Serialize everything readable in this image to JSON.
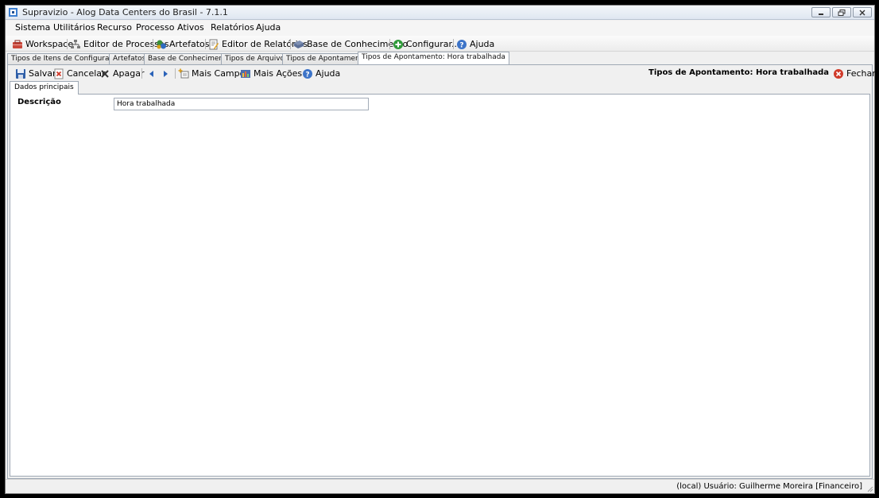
{
  "window": {
    "title": "Supravizio - Alog Data Centers do Brasil - 7.1.1"
  },
  "menubar": {
    "items": [
      "Sistema",
      "Utilitários",
      "Recurso",
      "Processo",
      "Ativos",
      "Relatórios",
      "Ajuda"
    ]
  },
  "toolbar": {
    "items": [
      {
        "label": "Workspace",
        "icon": "workspace-icon"
      },
      {
        "label": "Editor de Processos",
        "icon": "process-editor-icon"
      },
      {
        "label": "Artefatos",
        "icon": "artifacts-icon"
      },
      {
        "label": "Editor de Relatórios",
        "icon": "report-editor-icon"
      },
      {
        "label": "Base de Conhecimento",
        "icon": "knowledge-base-icon"
      },
      {
        "label": "Configurar...",
        "icon": "configure-icon"
      },
      {
        "label": "Ajuda",
        "icon": "help-icon"
      }
    ]
  },
  "doc_tabs": [
    {
      "label": "Tipos de Itens de Configuração",
      "active": false
    },
    {
      "label": "Artefatos",
      "active": false
    },
    {
      "label": "Base de Conhecimento",
      "active": false
    },
    {
      "label": "Tipos de Arquivos",
      "active": false
    },
    {
      "label": "Tipos de Apontamento",
      "active": false
    },
    {
      "label": "Tipos de Apontamento: Hora trabalhada",
      "active": true
    }
  ],
  "actions": {
    "save": "Salvar",
    "cancel": "Cancelar",
    "delete": "Apagar",
    "more_fields": "Mais Campos",
    "more_actions": "Mais Ações",
    "help": "Ajuda",
    "context_title": "Tipos de Apontamento: Hora trabalhada",
    "close": "Fechar"
  },
  "inner_tabs": [
    "Dados principais"
  ],
  "form": {
    "description_label": "Descrição",
    "description_value": "Hora trabalhada"
  },
  "status": {
    "text": "(local)  Usuário: Guilherme Moreira [Financeiro]"
  },
  "colors": {
    "accent_blue": "#2a62b8",
    "close_red": "#d03a2a",
    "panel_border": "#9ea8b4"
  }
}
